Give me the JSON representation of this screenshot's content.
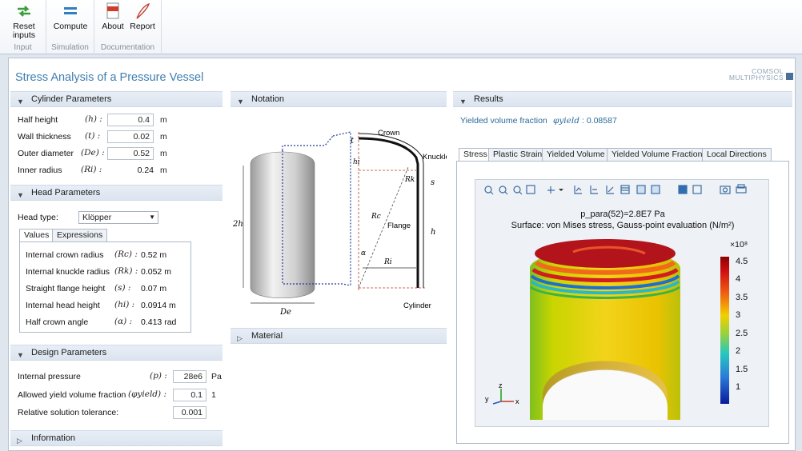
{
  "ribbon": {
    "groups": [
      {
        "label": "Input",
        "buttons": [
          {
            "label1": "Reset",
            "label2": "inputs"
          }
        ]
      },
      {
        "label": "Simulation",
        "buttons": [
          {
            "label1": "Compute",
            "label2": ""
          }
        ]
      },
      {
        "label": "Documentation",
        "buttons": [
          {
            "label1": "About",
            "label2": ""
          },
          {
            "label1": "Report",
            "label2": ""
          }
        ]
      }
    ]
  },
  "app": {
    "title": "Stress Analysis of a Pressure Vessel",
    "logo_line1": "COMSOL",
    "logo_line2": "MULTIPHYSICS"
  },
  "cylinder": {
    "header": "Cylinder Parameters",
    "rows": [
      {
        "label": "Half height",
        "sym": "(h) :",
        "value": "0.4",
        "unit": "m"
      },
      {
        "label": "Wall thickness",
        "sym": "(t) :",
        "value": "0.02",
        "unit": "m"
      },
      {
        "label": "Outer diameter",
        "sym": "(De) :",
        "value": "0.52",
        "unit": "m"
      },
      {
        "label": "Inner radius",
        "sym": "(Ri) :",
        "value": "0.24",
        "unit": "m"
      }
    ]
  },
  "head": {
    "header": "Head Parameters",
    "type_label": "Head type:",
    "type_value": "Klöpper",
    "tabs": [
      "Values",
      "Expressions"
    ],
    "rows": [
      {
        "label": "Internal crown radius",
        "sym": "(Rc) :",
        "value": "0.52 m"
      },
      {
        "label": "Internal knuckle radius",
        "sym": "(Rk) :",
        "value": "0.052 m"
      },
      {
        "label": "Straight flange height",
        "sym": "(s) :",
        "value": "0.07 m"
      },
      {
        "label": "Internal head height",
        "sym": "(hi) :",
        "value": "0.0914 m"
      },
      {
        "label": "Half crown angle",
        "sym": "(α) :",
        "value": "0.413 rad"
      }
    ]
  },
  "design": {
    "header": "Design Parameters",
    "rows": [
      {
        "label": "Internal pressure",
        "sym": "(p) :",
        "value": "28e6",
        "unit": "Pa"
      },
      {
        "label": "Allowed yield volume fraction",
        "sym": "(φyield) :",
        "value": "0.1",
        "unit": "1"
      },
      {
        "label": "Relative solution tolerance:",
        "sym": "",
        "value": "0.001",
        "unit": ""
      }
    ]
  },
  "information": {
    "header": "Information"
  },
  "notation": {
    "header": "Notation",
    "labels": {
      "crown": "Crown",
      "knuckle": "Knuckle",
      "flange": "Flange",
      "cylinder": "Cylinder",
      "t": "t",
      "hi": "hi",
      "Rk": "Rk",
      "Rc": "Rc",
      "Ri": "Ri",
      "s": "s",
      "h": "h",
      "alpha": "α",
      "twoh": "2h",
      "De": "De"
    }
  },
  "material": {
    "header": "Material"
  },
  "results": {
    "header": "Results",
    "yield_label": "Yielded volume fraction",
    "yield_sym": "φyield",
    "yield_value": ": 0.08587",
    "tabs": [
      "Stress",
      "Plastic Strain",
      "Yielded Volume",
      "Yielded Volume Fraction",
      "Local Directions"
    ],
    "plot_title1": "p_para(52)=2.8E7 Pa",
    "plot_title2": "Surface: von Mises stress, Gauss-point evaluation (N/m²)",
    "colorbar": {
      "multiplier": "×10⁸",
      "ticks": [
        "4.5",
        "4",
        "3.5",
        "3",
        "2.5",
        "2",
        "1.5",
        "1"
      ]
    },
    "axes": {
      "x": "x",
      "y": "y",
      "z": "z"
    }
  },
  "colors": {
    "accent": "#3f7fb0",
    "header_bg": "#dbe4ef"
  }
}
